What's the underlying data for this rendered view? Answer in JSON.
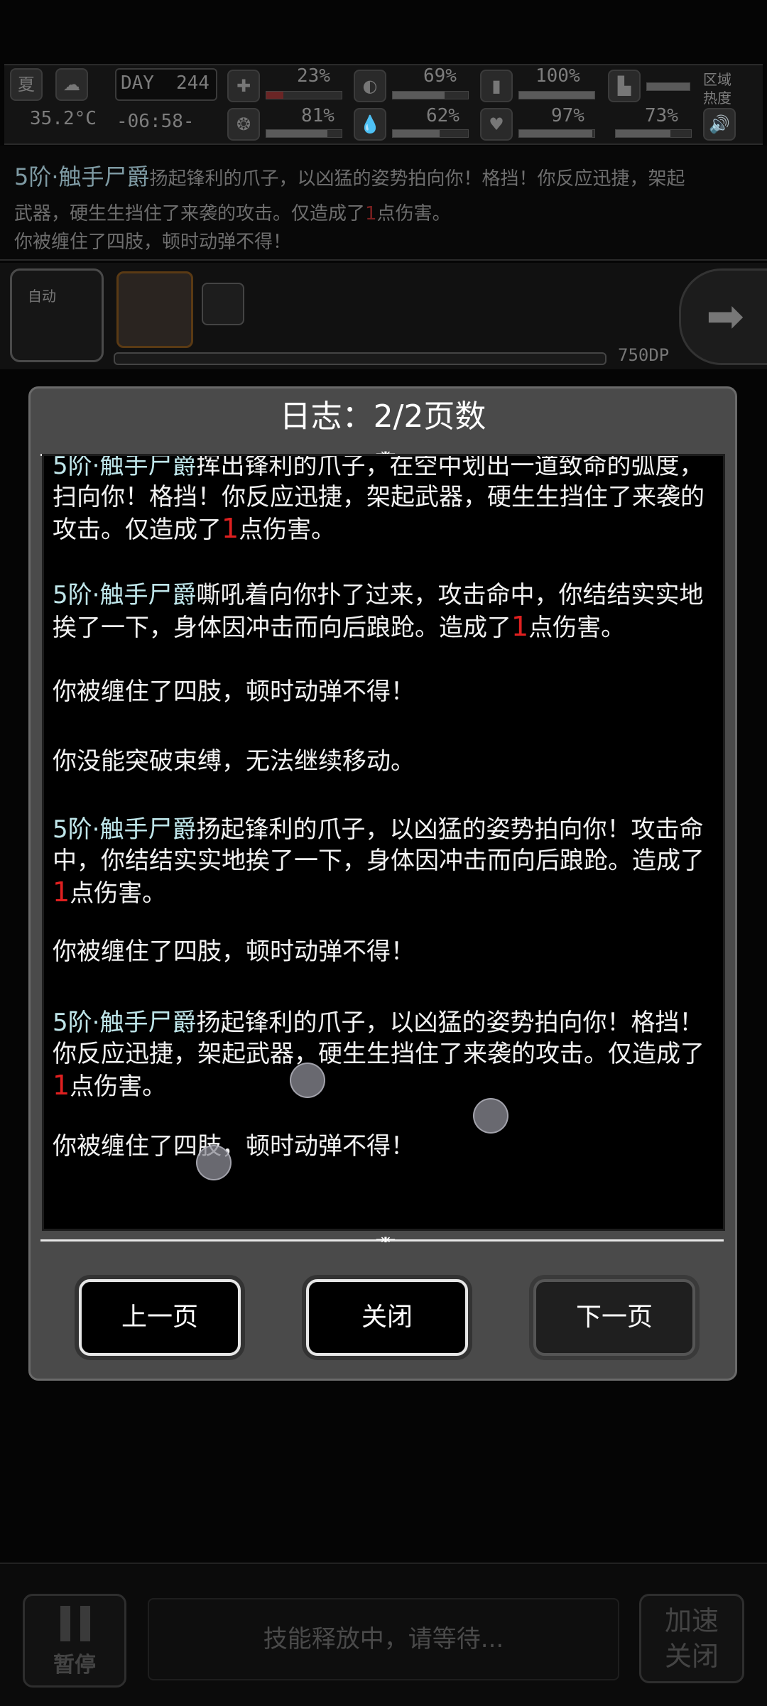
{
  "hud": {
    "season": "夏",
    "day_label": "DAY",
    "day": "244",
    "temperature": "35.2°C",
    "time": "-06:58-",
    "stats": [
      {
        "name": "health",
        "value": "23%",
        "level": 0.23
      },
      {
        "name": "hunger",
        "value": "69%",
        "level": 0.69
      },
      {
        "name": "stamina",
        "value": "100%",
        "level": 1.0
      },
      {
        "name": "brain",
        "value": "81%",
        "level": 0.81
      },
      {
        "name": "thirst",
        "value": "62%",
        "level": 0.62
      },
      {
        "name": "heart",
        "value": "97%",
        "level": 0.97
      },
      {
        "name": "foot",
        "value": "73%",
        "level": 0.73
      }
    ],
    "area_heat_label_1": "区域",
    "area_heat_label_2": "热度",
    "auto_label": "自动",
    "progress_text": "750DP"
  },
  "background_log": {
    "line1_enemy": "5阶·触手尸爵",
    "line1_rest": "扬起锋利的爪子，以凶猛的姿势拍向你！格挡！你反应迅捷，架起",
    "line2": "武器，硬生生挡住了来袭的攻击。仅造成了",
    "line2_num": "1",
    "line2_end": "点伤害。",
    "line3": "你被缠住了四肢，顿时动弹不得！"
  },
  "modal": {
    "title": "日志：2/2页数",
    "entries": [
      {
        "enemy": "5阶·触手尸爵",
        "text": "挥出锋利的爪子，在空中划出一道致命的弧度，扫向你！格挡！你反应迅捷，架起武器，硬生生挡住了来袭的攻击。仅造成了",
        "dmg": "1",
        "end": "点伤害。"
      },
      {
        "enemy": "5阶·触手尸爵",
        "text": "嘶吼着向你扑了过来，攻击命中，你结结实实地挨了一下，身体因冲击而向后踉跄。造成了",
        "dmg": "1",
        "end": "点伤害。"
      },
      {
        "text": "你被缠住了四肢，顿时动弹不得！"
      },
      {
        "text": "你没能突破束缚，无法继续移动。"
      },
      {
        "enemy": "5阶·触手尸爵",
        "text": "扬起锋利的爪子，以凶猛的姿势拍向你！攻击命中，你结结实实地挨了一下，身体因冲击而向后踉跄。造成了",
        "dmg": "1",
        "end": "点伤害。"
      },
      {
        "text": "你被缠住了四肢，顿时动弹不得！"
      },
      {
        "enemy": "5阶·触手尸爵",
        "text": "扬起锋利的爪子，以凶猛的姿势拍向你！格挡！你反应迅捷，架起武器，硬生生挡住了来袭的攻击。仅造成了",
        "dmg": "1",
        "end": "点伤害。"
      },
      {
        "text": "你被缠住了四肢，顿时动弹不得！"
      }
    ],
    "prev_label": "上一页",
    "close_label": "关闭",
    "next_label": "下一页"
  },
  "bottom": {
    "pause_label": "暂停",
    "skill_wait_text": "技能释放中，请等待...",
    "speed_label_1": "加速",
    "speed_label_2": "关闭"
  }
}
